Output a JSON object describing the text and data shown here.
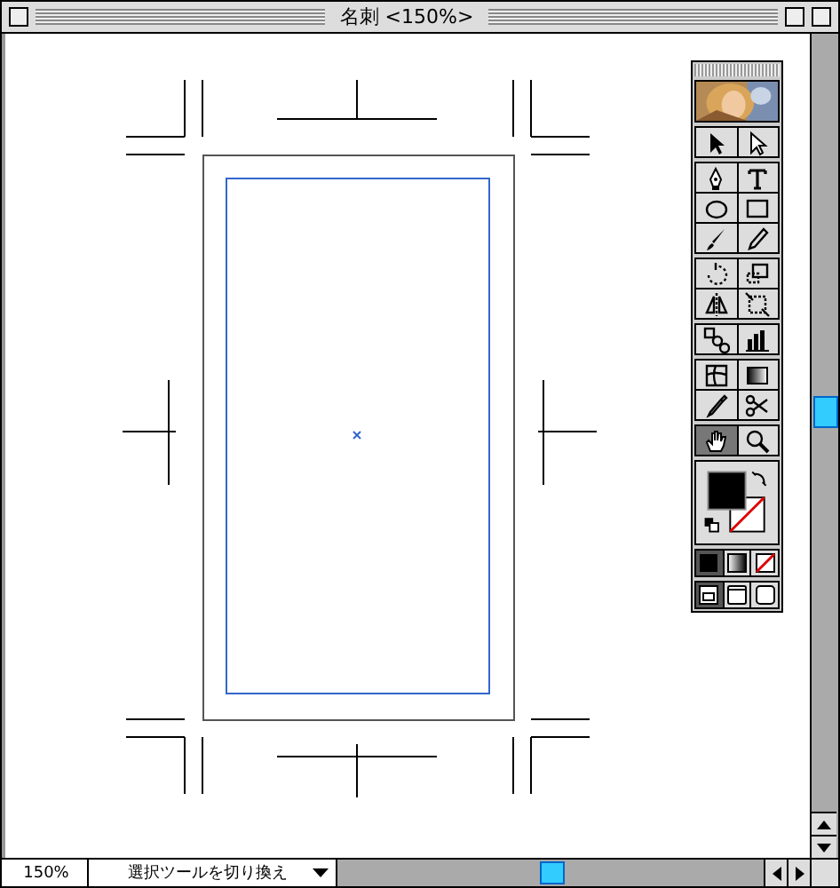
{
  "window": {
    "title": "名刺 <150%>"
  },
  "toolbox": {
    "groups": [
      [
        {
          "kind": "selection",
          "selected": false
        },
        {
          "kind": "direct-selection",
          "selected": false
        }
      ],
      [
        {
          "kind": "pen",
          "selected": false
        },
        {
          "kind": "type",
          "selected": false
        },
        {
          "kind": "ellipse",
          "selected": false
        },
        {
          "kind": "rectangle",
          "selected": false
        },
        {
          "kind": "brush",
          "selected": false
        },
        {
          "kind": "pencil",
          "selected": false
        }
      ],
      [
        {
          "kind": "rotate",
          "selected": false
        },
        {
          "kind": "scale",
          "selected": false
        },
        {
          "kind": "reflect",
          "selected": false
        },
        {
          "kind": "free-transform",
          "selected": false
        }
      ],
      [
        {
          "kind": "blend",
          "selected": false
        },
        {
          "kind": "graph",
          "selected": false
        }
      ],
      [
        {
          "kind": "mesh",
          "selected": false
        },
        {
          "kind": "gradient",
          "selected": false
        },
        {
          "kind": "eyedropper",
          "selected": false
        },
        {
          "kind": "scissors",
          "selected": false
        }
      ],
      [
        {
          "kind": "hand",
          "selected": true
        },
        {
          "kind": "zoom",
          "selected": false
        }
      ]
    ],
    "paint_modes": [
      {
        "kind": "color",
        "selected": true
      },
      {
        "kind": "gradient",
        "selected": false
      },
      {
        "kind": "none",
        "selected": false
      }
    ],
    "screen_modes": [
      {
        "kind": "standard",
        "selected": true
      },
      {
        "kind": "full-menu",
        "selected": false
      },
      {
        "kind": "full",
        "selected": false
      }
    ]
  },
  "status_bar": {
    "zoom": "150%",
    "tool_info": "選択ツールを切り換え"
  }
}
